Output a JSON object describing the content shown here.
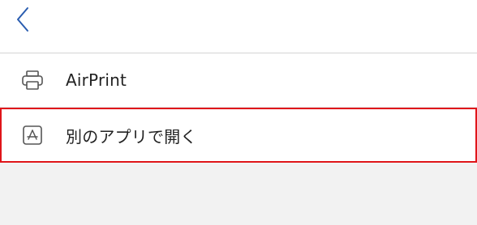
{
  "nav": {
    "back_icon": "chevron-left-icon",
    "accent_color": "#2a5db0"
  },
  "menu": {
    "items": [
      {
        "label": "AirPrint",
        "icon": "printer-icon",
        "highlighted": false
      },
      {
        "label": "別のアプリで開く",
        "icon": "app-store-icon",
        "highlighted": true
      }
    ]
  },
  "colors": {
    "highlight_border": "#e0151a",
    "background": "#f2f2f2"
  }
}
